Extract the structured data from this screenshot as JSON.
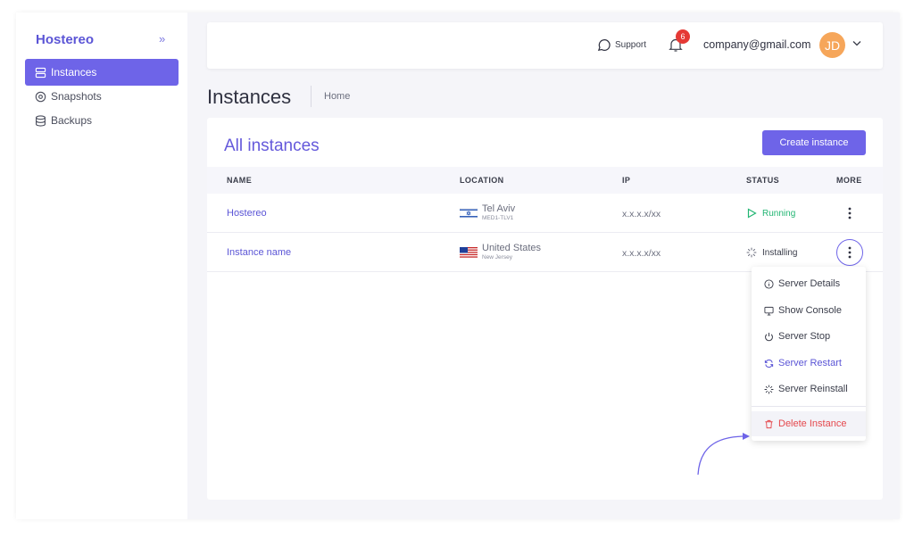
{
  "sidebar": {
    "brand": "Hostereo",
    "collapse_icon": "double-chevron-right-icon",
    "items": [
      {
        "label": "Instances",
        "icon": "server-icon",
        "active": true
      },
      {
        "label": "Snapshots",
        "icon": "disc-icon",
        "active": false
      },
      {
        "label": "Backups",
        "icon": "database-icon",
        "active": false
      }
    ]
  },
  "topbar": {
    "support_label": "Support",
    "notification_count": "6",
    "email": "company@gmail.com",
    "avatar_initials": "JD"
  },
  "page": {
    "title": "Instances",
    "breadcrumb": "Home"
  },
  "card": {
    "title": "All instances",
    "create_label": "Create instance"
  },
  "table": {
    "headers": [
      "NAME",
      "LOCATION",
      "IP",
      "STATUS",
      "MORE"
    ],
    "rows": [
      {
        "name": "Hostereo",
        "location": "Tel Aviv",
        "location_sub": "MED1-TLV1",
        "flag": "israel-flag",
        "ip": "x.x.x.x/xx",
        "status": "Running",
        "status_color": "#22b573"
      },
      {
        "name": "Instance name",
        "location": "United States",
        "location_sub": "New Jersey",
        "flag": "us-flag",
        "ip": "x.x.x.x/xx",
        "status": "Installing",
        "status_color": "#3a3d4a"
      }
    ]
  },
  "menu": {
    "items": [
      {
        "label": "Server Details",
        "icon": "info-icon"
      },
      {
        "label": "Show Console",
        "icon": "monitor-icon"
      },
      {
        "label": "Server Stop",
        "icon": "power-icon"
      },
      {
        "label": "Server Restart",
        "icon": "refresh-icon"
      },
      {
        "label": "Server Reinstall",
        "icon": "spinner-icon"
      },
      {
        "label": "Delete Instance",
        "icon": "trash-icon"
      }
    ]
  },
  "colors": {
    "accent": "#6e64e8",
    "danger": "#e5484d",
    "running": "#22b573"
  }
}
